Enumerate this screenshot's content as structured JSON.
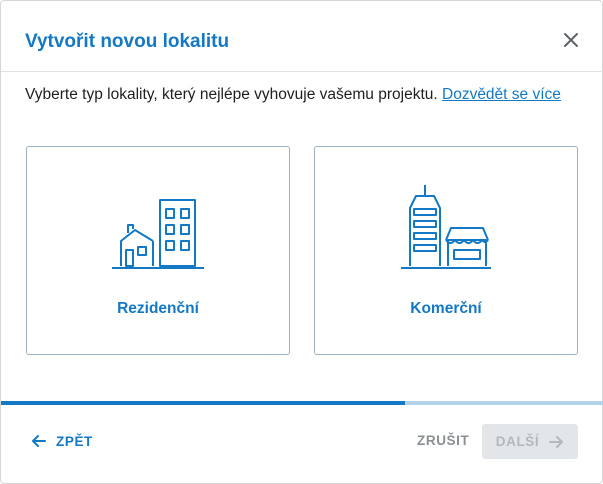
{
  "dialog": {
    "title": "Vytvořit novou lokalitu",
    "intro_text": "Vyberte typ lokality, který nejlépe vyhovuje vašemu projektu.",
    "learn_more_link": "Dozvědět se více"
  },
  "cards": [
    {
      "label": "Rezidenční",
      "icon": "residential-buildings-icon"
    },
    {
      "label": "Komerční",
      "icon": "commercial-buildings-icon"
    }
  ],
  "progress": {
    "fraction": 0.67
  },
  "footer": {
    "back_label": "ZPĚT",
    "cancel_label": "ZRUŠIT",
    "next_label": "DALŠÍ",
    "next_disabled": true
  },
  "colors": {
    "accent": "#1479c4",
    "progress_track": "#b3d3ea",
    "disabled_bg": "#e3e6e9",
    "disabled_text": "#b4b8bc"
  }
}
